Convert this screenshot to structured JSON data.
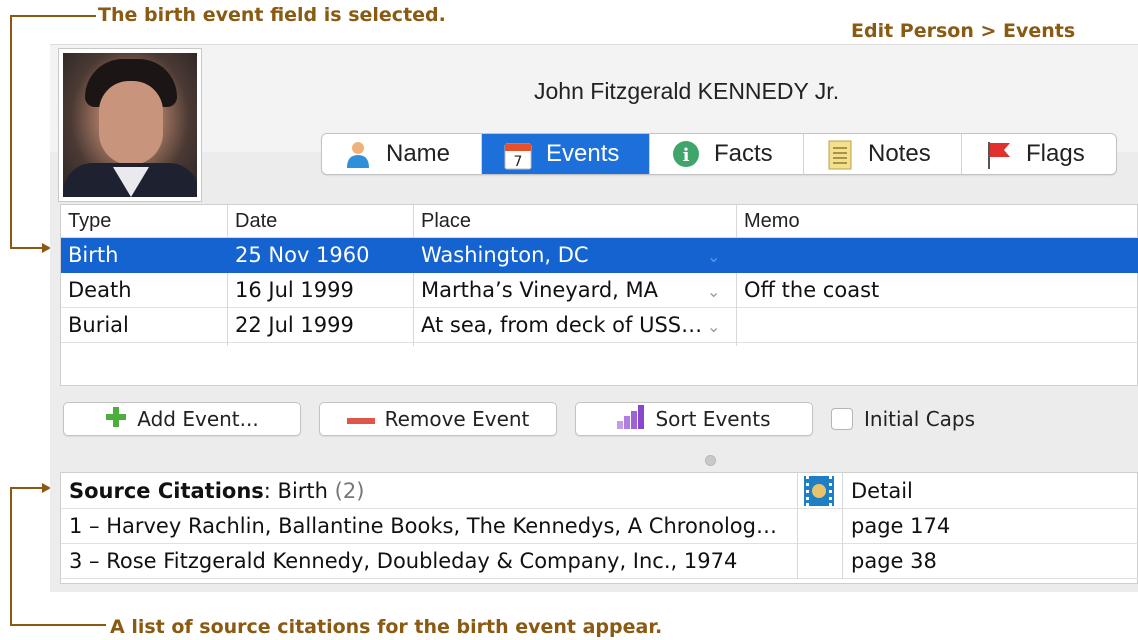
{
  "annotations": {
    "top": "The birth event field is selected.",
    "top_right": "Edit Person > Events",
    "bottom": "A list of source citations for the birth event appear."
  },
  "person": {
    "name": "John Fitzgerald KENNEDY Jr."
  },
  "tabs": [
    {
      "label": "Name",
      "icon": "person-icon"
    },
    {
      "label": "Events",
      "icon": "calendar-icon",
      "icon_text": "7",
      "active": true
    },
    {
      "label": "Facts",
      "icon": "info-icon",
      "icon_text": "i"
    },
    {
      "label": "Notes",
      "icon": "notes-icon"
    },
    {
      "label": "Flags",
      "icon": "flag-icon"
    }
  ],
  "events": {
    "columns": [
      "Type",
      "Date",
      "Place",
      "Memo"
    ],
    "rows": [
      {
        "type": "Birth",
        "date": "25 Nov 1960",
        "place": "Washington, DC",
        "memo": "",
        "selected": true
      },
      {
        "type": "Death",
        "date": "16 Jul 1999",
        "place": "Martha’s Vineyard, MA",
        "memo": "Off the coast"
      },
      {
        "type": "Burial",
        "date": "22 Jul 1999",
        "place": "At sea, from deck of USS…",
        "memo": ""
      }
    ]
  },
  "buttons": {
    "add": "Add Event...",
    "remove": "Remove Event",
    "sort": "Sort Events",
    "initial_caps": "Initial Caps"
  },
  "citations": {
    "title_bold": "Source Citations",
    "title_rest": ": Birth",
    "count": "(2)",
    "detail_header": "Detail",
    "rows": [
      {
        "text": "1 – Harvey Rachlin, Ballantine Books, The Kennedys, A Chronolog…",
        "detail": "page 174"
      },
      {
        "text": "3 – Rose Fitzgerald Kennedy, Doubleday & Company, Inc., 1974",
        "detail": "page 38"
      }
    ]
  },
  "colors": {
    "annotation": "#8a5a12",
    "selection": "#1463d1",
    "tab_active": "#1d6fd9"
  }
}
